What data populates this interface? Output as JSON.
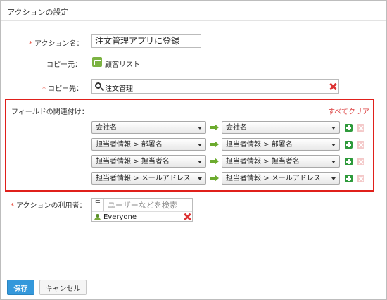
{
  "dialog": {
    "title": "アクションの設定"
  },
  "fields": {
    "action_name": {
      "required": "*",
      "label": "アクション名：",
      "value": "注文管理アプリに登録"
    },
    "copy_source": {
      "label": "コピー元：",
      "app_name": "顧客リスト"
    },
    "copy_dest": {
      "required": "*",
      "label": "コピー先：",
      "value": "注文管理"
    }
  },
  "mapping": {
    "label": "フィールドの関連付け：",
    "clear_all": "すべてクリア",
    "rows": [
      {
        "from": "会社名",
        "to": "会社名"
      },
      {
        "from": "担当者情報 > 部署名",
        "to": "担当者情報 > 部署名"
      },
      {
        "from": "担当者情報 > 担当者名",
        "to": "担当者情報 > 担当者名"
      },
      {
        "from": "担当者情報 > メールアドレス",
        "to": "担当者情報 > メールアドレス"
      }
    ]
  },
  "users": {
    "required": "*",
    "label": "アクションの利用者：",
    "placeholder": "ユーザーなどを検索",
    "selected": [
      "Everyone"
    ]
  },
  "footer": {
    "save": "保存",
    "cancel": "キャンセル"
  },
  "colors": {
    "required": "#e74c3c",
    "highlight_border": "#e0201b",
    "save_button": "#3498db",
    "add_button": "#2e9a3b"
  },
  "icons": {
    "app": "app-icon",
    "search": "search-icon",
    "clear": "clear-icon",
    "arrow": "arrow-right-icon",
    "add": "add-icon",
    "remove": "remove-icon",
    "user_group": "user-group-icon"
  }
}
